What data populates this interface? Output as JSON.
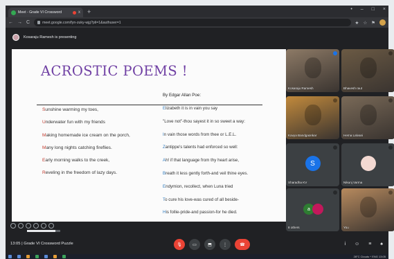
{
  "browser": {
    "tab_title": "Meet - Grade VI Crossword",
    "tab_close": "x",
    "new_tab": "+",
    "url": "meet.google.com/fyn-zuky-wjg?pli=1&authuser=1",
    "window_controls": [
      "•",
      "–",
      "□",
      "×"
    ],
    "nav_icons": [
      "←",
      "→",
      "C"
    ],
    "right_icons": [
      "★",
      "☆",
      "⚑"
    ]
  },
  "presenting": {
    "text": "Kosaraju Ramesh is presenting"
  },
  "slide": {
    "title": "ACROSTIC POEMS !",
    "byline": "By Edgar Allan Poe:",
    "left_poem": [
      {
        "cap": "S",
        "rest": "unshine warming my toes,"
      },
      {
        "cap": "U",
        "rest": "nderwater fun with my friends"
      },
      {
        "cap": "M",
        "rest": "aking homemade ice cream on the porch,"
      },
      {
        "cap": "M",
        "rest": "any long nights catching fireflies."
      },
      {
        "cap": "E",
        "rest": "arly morning walks to the creek,"
      },
      {
        "cap": "R",
        "rest": "eveling in the freedom of lazy days."
      }
    ],
    "right_poem": [
      {
        "cap": "E",
        "rest": "lizabeth  it is in vain you say"
      },
      {
        "cap": "",
        "rest": "\"Love not\"-thou sayest it in so sweet a way:"
      },
      {
        "cap": "I",
        "rest": "n vain those words from thee or L.E.L."
      },
      {
        "cap": "Z",
        "rest": "antippe's talents had enforced so well:"
      },
      {
        "cap": "A",
        "rest": "h! if that language from thy heart arise,"
      },
      {
        "cap": "B",
        "rest": "reath it less gently forth-and veil thine eyes."
      },
      {
        "cap": "E",
        "rest": "ndymion, recollect, when Luna tried"
      },
      {
        "cap": "T",
        "rest": "o cure his love-was cured of all beside-"
      },
      {
        "cap": "H",
        "rest": "is follie-pride-and passion-for he died."
      }
    ],
    "progress": 0.85
  },
  "participants": [
    {
      "name": "Kosaraju Ramesh",
      "mic_active": true,
      "kind": "video",
      "bg": "#8d7a66"
    },
    {
      "name": "Bhavesh raut",
      "mic_active": false,
      "kind": "video",
      "bg": "#6b5a44"
    },
    {
      "name": "Kavya Bandgaonkar",
      "mic_active": false,
      "kind": "video",
      "bg": "#c28a3c"
    },
    {
      "name": "Hema Lalvani",
      "mic_active": false,
      "kind": "video",
      "bg": "#7a6a58"
    },
    {
      "name": "Sharadha KV",
      "mic_active": false,
      "kind": "letter",
      "letter": "S",
      "color": "#1a73e8"
    },
    {
      "name": "Nikunj Varma",
      "mic_active": false,
      "kind": "avatar",
      "color": "#f3d9d2"
    },
    {
      "name": "8 others",
      "mic_active": false,
      "kind": "others",
      "letter": "a",
      "color": "#2e7d32"
    },
    {
      "name": "You",
      "mic_active": false,
      "kind": "video",
      "bg": "#b78a5e"
    }
  ],
  "bottom": {
    "meeting_info": "13:05  |  Grade VI Crossword Puzzle",
    "controls": [
      "mic-off",
      "camera",
      "present",
      "more",
      "end-call"
    ],
    "right_icons": [
      "i",
      "☺",
      "≡",
      "♠"
    ]
  },
  "taskbar": {
    "tray_text": "28°C  Clouds  ^  ENG  13:05"
  },
  "colors": {
    "title": "#6f3fa3",
    "left_initial": "#c0392b",
    "right_initial": "#2e7bbf",
    "end_call": "#ea4335"
  }
}
